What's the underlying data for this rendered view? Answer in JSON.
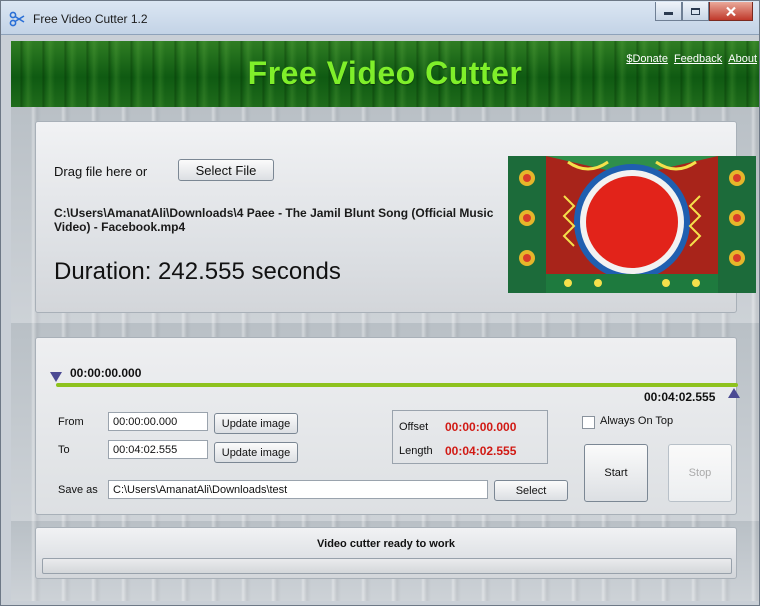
{
  "window": {
    "title": "Free Video Cutter 1.2"
  },
  "banner": {
    "title": "Free Video Cutter",
    "links": [
      "$Donate",
      "Feedback",
      "About"
    ]
  },
  "file_panel": {
    "drag_label": "Drag file here or",
    "select_file_label": "Select File",
    "file_path": "C:\\Users\\AmanatAli\\Downloads\\4 Paee - The Jamil Blunt Song (Official Music Video) - Facebook.mp4",
    "duration_text": "Duration: 242.555 seconds"
  },
  "timeline": {
    "start_time": "00:00:00.000",
    "end_time": "00:04:02.555",
    "accent_color": "#8ec21d",
    "marker_color": "#4b4a93"
  },
  "cut_panel": {
    "from_label": "From",
    "from_value": "00:00:00.000",
    "to_label": "To",
    "to_value": "00:04:02.555",
    "update_image_label": "Update image",
    "offset_label": "Offset",
    "offset_value": "00:00:00.000",
    "length_label": "Length",
    "length_value": "00:04:02.555",
    "always_on_top_label": "Always On Top",
    "always_on_top_checked": false,
    "save_as_label": "Save as",
    "save_as_value": "C:\\Users\\AmanatAli\\Downloads\\test",
    "select_label": "Select",
    "start_label": "Start",
    "stop_label": "Stop",
    "value_color": "#d11a14"
  },
  "status": {
    "text": "Video cutter ready to work",
    "progress": 0
  },
  "icons": {
    "app": "scissors-icon",
    "minimize": "minimize-icon",
    "maximize": "maximize-icon",
    "close": "close-icon"
  }
}
